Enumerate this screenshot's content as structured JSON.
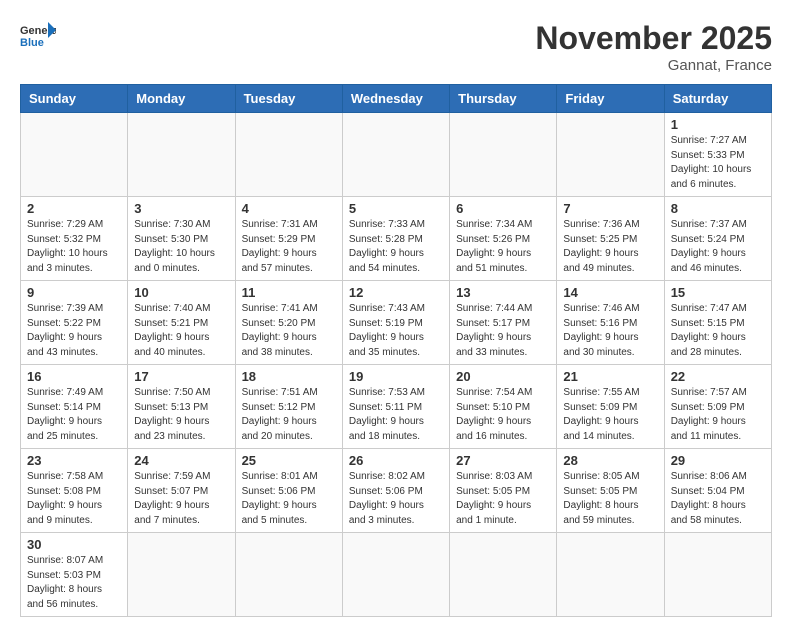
{
  "header": {
    "logo_general": "General",
    "logo_blue": "Blue",
    "month_title": "November 2025",
    "location": "Gannat, France"
  },
  "days_of_week": [
    "Sunday",
    "Monday",
    "Tuesday",
    "Wednesday",
    "Thursday",
    "Friday",
    "Saturday"
  ],
  "weeks": [
    [
      {
        "day": "",
        "info": ""
      },
      {
        "day": "",
        "info": ""
      },
      {
        "day": "",
        "info": ""
      },
      {
        "day": "",
        "info": ""
      },
      {
        "day": "",
        "info": ""
      },
      {
        "day": "",
        "info": ""
      },
      {
        "day": "1",
        "info": "Sunrise: 7:27 AM\nSunset: 5:33 PM\nDaylight: 10 hours\nand 6 minutes."
      }
    ],
    [
      {
        "day": "2",
        "info": "Sunrise: 7:29 AM\nSunset: 5:32 PM\nDaylight: 10 hours\nand 3 minutes."
      },
      {
        "day": "3",
        "info": "Sunrise: 7:30 AM\nSunset: 5:30 PM\nDaylight: 10 hours\nand 0 minutes."
      },
      {
        "day": "4",
        "info": "Sunrise: 7:31 AM\nSunset: 5:29 PM\nDaylight: 9 hours\nand 57 minutes."
      },
      {
        "day": "5",
        "info": "Sunrise: 7:33 AM\nSunset: 5:28 PM\nDaylight: 9 hours\nand 54 minutes."
      },
      {
        "day": "6",
        "info": "Sunrise: 7:34 AM\nSunset: 5:26 PM\nDaylight: 9 hours\nand 51 minutes."
      },
      {
        "day": "7",
        "info": "Sunrise: 7:36 AM\nSunset: 5:25 PM\nDaylight: 9 hours\nand 49 minutes."
      },
      {
        "day": "8",
        "info": "Sunrise: 7:37 AM\nSunset: 5:24 PM\nDaylight: 9 hours\nand 46 minutes."
      }
    ],
    [
      {
        "day": "9",
        "info": "Sunrise: 7:39 AM\nSunset: 5:22 PM\nDaylight: 9 hours\nand 43 minutes."
      },
      {
        "day": "10",
        "info": "Sunrise: 7:40 AM\nSunset: 5:21 PM\nDaylight: 9 hours\nand 40 minutes."
      },
      {
        "day": "11",
        "info": "Sunrise: 7:41 AM\nSunset: 5:20 PM\nDaylight: 9 hours\nand 38 minutes."
      },
      {
        "day": "12",
        "info": "Sunrise: 7:43 AM\nSunset: 5:19 PM\nDaylight: 9 hours\nand 35 minutes."
      },
      {
        "day": "13",
        "info": "Sunrise: 7:44 AM\nSunset: 5:17 PM\nDaylight: 9 hours\nand 33 minutes."
      },
      {
        "day": "14",
        "info": "Sunrise: 7:46 AM\nSunset: 5:16 PM\nDaylight: 9 hours\nand 30 minutes."
      },
      {
        "day": "15",
        "info": "Sunrise: 7:47 AM\nSunset: 5:15 PM\nDaylight: 9 hours\nand 28 minutes."
      }
    ],
    [
      {
        "day": "16",
        "info": "Sunrise: 7:49 AM\nSunset: 5:14 PM\nDaylight: 9 hours\nand 25 minutes."
      },
      {
        "day": "17",
        "info": "Sunrise: 7:50 AM\nSunset: 5:13 PM\nDaylight: 9 hours\nand 23 minutes."
      },
      {
        "day": "18",
        "info": "Sunrise: 7:51 AM\nSunset: 5:12 PM\nDaylight: 9 hours\nand 20 minutes."
      },
      {
        "day": "19",
        "info": "Sunrise: 7:53 AM\nSunset: 5:11 PM\nDaylight: 9 hours\nand 18 minutes."
      },
      {
        "day": "20",
        "info": "Sunrise: 7:54 AM\nSunset: 5:10 PM\nDaylight: 9 hours\nand 16 minutes."
      },
      {
        "day": "21",
        "info": "Sunrise: 7:55 AM\nSunset: 5:09 PM\nDaylight: 9 hours\nand 14 minutes."
      },
      {
        "day": "22",
        "info": "Sunrise: 7:57 AM\nSunset: 5:09 PM\nDaylight: 9 hours\nand 11 minutes."
      }
    ],
    [
      {
        "day": "23",
        "info": "Sunrise: 7:58 AM\nSunset: 5:08 PM\nDaylight: 9 hours\nand 9 minutes."
      },
      {
        "day": "24",
        "info": "Sunrise: 7:59 AM\nSunset: 5:07 PM\nDaylight: 9 hours\nand 7 minutes."
      },
      {
        "day": "25",
        "info": "Sunrise: 8:01 AM\nSunset: 5:06 PM\nDaylight: 9 hours\nand 5 minutes."
      },
      {
        "day": "26",
        "info": "Sunrise: 8:02 AM\nSunset: 5:06 PM\nDaylight: 9 hours\nand 3 minutes."
      },
      {
        "day": "27",
        "info": "Sunrise: 8:03 AM\nSunset: 5:05 PM\nDaylight: 9 hours\nand 1 minute."
      },
      {
        "day": "28",
        "info": "Sunrise: 8:05 AM\nSunset: 5:05 PM\nDaylight: 8 hours\nand 59 minutes."
      },
      {
        "day": "29",
        "info": "Sunrise: 8:06 AM\nSunset: 5:04 PM\nDaylight: 8 hours\nand 58 minutes."
      }
    ],
    [
      {
        "day": "30",
        "info": "Sunrise: 8:07 AM\nSunset: 5:03 PM\nDaylight: 8 hours\nand 56 minutes."
      },
      {
        "day": "",
        "info": ""
      },
      {
        "day": "",
        "info": ""
      },
      {
        "day": "",
        "info": ""
      },
      {
        "day": "",
        "info": ""
      },
      {
        "day": "",
        "info": ""
      },
      {
        "day": "",
        "info": ""
      }
    ]
  ]
}
